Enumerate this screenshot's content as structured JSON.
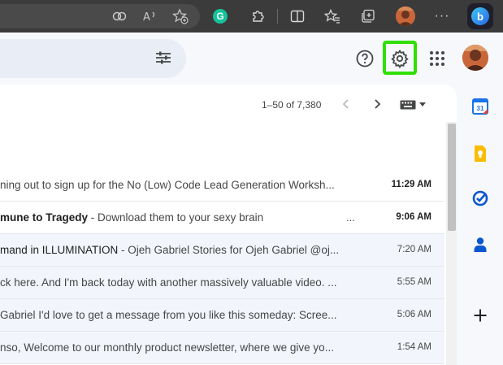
{
  "browser": {
    "grammarly_letter": "G",
    "bing_letter": "b"
  },
  "pager": {
    "range_text": "1–50 of 7,380"
  },
  "emails": [
    {
      "subject": "",
      "snippet": "ning out to sign up for the No (Low) Code Lead Generation Worksh...",
      "time": "11:29 AM",
      "unread": true
    },
    {
      "subject": "mune to Tragedy",
      "snippet": " - Download them to your sexy brain",
      "trailing": "...",
      "time": "9:06 AM",
      "unread": true
    },
    {
      "subject": "mand in ILLUMINATION",
      "snippet": " - Ojeh Gabriel Stories for Ojeh Gabriel @oj...",
      "time": "7:20 AM",
      "unread": false
    },
    {
      "subject": "",
      "snippet": "ck here. And I'm back today with another massively valuable video. ...",
      "time": "5:55 AM",
      "unread": false
    },
    {
      "subject": "",
      "snippet": " Gabriel I'd love to get a message from you like this someday: Scree...",
      "time": "5:06 AM",
      "unread": false
    },
    {
      "subject": "",
      "snippet": "nso, Welcome to our monthly product newsletter, where we give yo...",
      "time": "1:54 AM",
      "unread": false
    }
  ],
  "sidepanel": {
    "calendar_day": "31",
    "add_symbol": "+"
  },
  "colors": {
    "highlight": "#2fe000",
    "calendar_blue": "#1a73e8",
    "keep_yellow": "#fbbc04",
    "tasks_blue": "#0b57d0",
    "contacts_blue": "#0b57d0"
  },
  "icons": [
    "split-view-icon",
    "read-aloud-icon",
    "favorite-add-icon",
    "grammarly-icon",
    "extensions-icon",
    "split-screen-icon",
    "favorites-icon",
    "collections-icon",
    "profile-icon",
    "more-icon",
    "bing-copilot-icon",
    "search-options-icon",
    "help-icon",
    "settings-icon",
    "apps-icon",
    "calendar-icon",
    "keep-icon",
    "tasks-icon",
    "contacts-icon",
    "add-icon"
  ]
}
